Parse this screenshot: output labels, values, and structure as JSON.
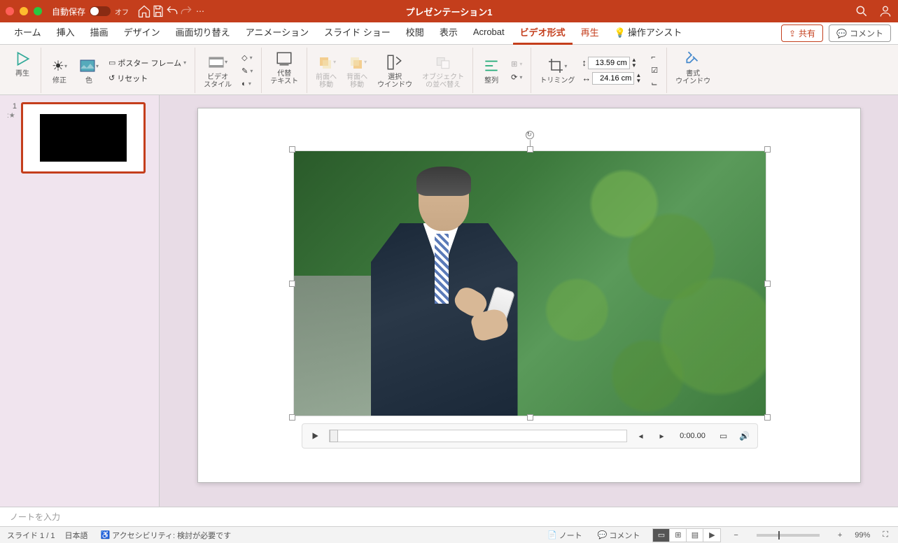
{
  "title": "プレゼンテーション1",
  "autosave": {
    "label": "自動保存",
    "state": "オフ"
  },
  "tabs": {
    "home": "ホーム",
    "insert": "挿入",
    "draw": "描画",
    "design": "デザイン",
    "transitions": "画面切り替え",
    "animations": "アニメーション",
    "slideshow": "スライド ショー",
    "review": "校閲",
    "view": "表示",
    "acrobat": "Acrobat",
    "videoformat": "ビデオ形式",
    "playback": "再生",
    "tellme": "操作アシスト"
  },
  "topbtn": {
    "share": "共有",
    "comment": "コメント"
  },
  "ribbon": {
    "play": "再生",
    "corrections": "修正",
    "color": "色",
    "poster": "ポスター フレーム",
    "reset": "リセット",
    "videostyles": "ビデオ\nスタイル",
    "alttext": "代替\nテキスト",
    "bringfwd": "前面へ\n移動",
    "sendback": "背面へ\n移動",
    "selpane": "選択\nウインドウ",
    "reorder": "オブジェクト\nの並べ替え",
    "align": "整列",
    "trimming": "トリミング",
    "height": "13.59 cm",
    "width": "24.16 cm",
    "formatpane": "書式\nウインドウ"
  },
  "thumb": {
    "num": "1",
    "star": ":★"
  },
  "player": {
    "time": "0:00.00"
  },
  "notes": {
    "placeholder": "ノートを入力"
  },
  "status": {
    "slide": "スライド 1 / 1",
    "lang": "日本語",
    "a11y": "アクセシビリティ: 検討が必要です",
    "notes": "ノート",
    "comments": "コメント",
    "zoom": "99%"
  }
}
